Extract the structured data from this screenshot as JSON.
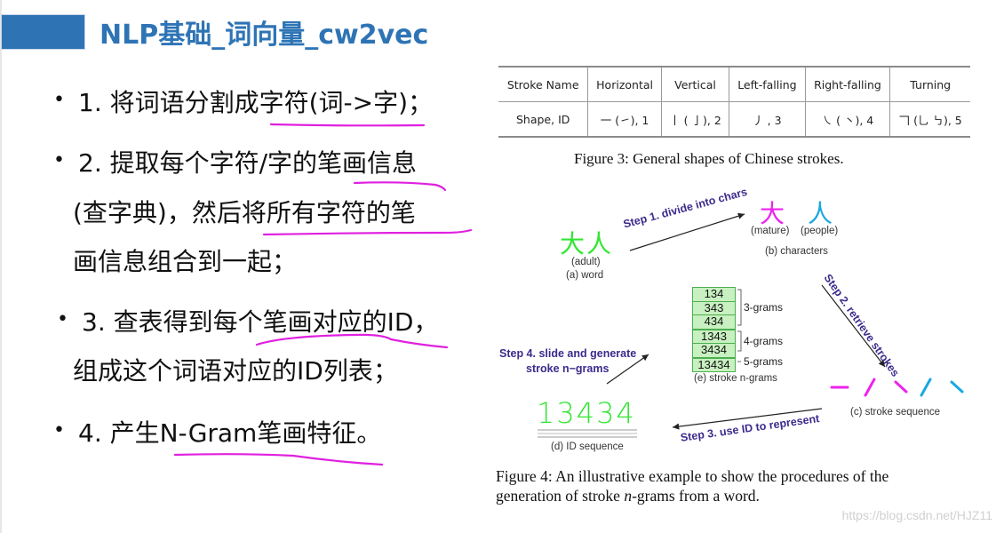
{
  "title": "NLP基础_词向量_cw2vec",
  "colors": {
    "title": "#2e74b5",
    "underline": "#e020e0",
    "green": "#33e633",
    "magenta": "#ee22ee",
    "cyan": "#1aa8e0",
    "step": "#3d2a8c"
  },
  "bullets": [
    {
      "lines": [
        "1. 将词语分割成字符(词->字)；"
      ]
    },
    {
      "lines": [
        "2. 提取每个字符/字的笔画信息",
        "(查字典)，然后将所有字符的笔",
        "画信息组合到一起；"
      ]
    },
    {
      "lines": [
        "3. 查表得到每个笔画对应的ID，",
        "组成这个词语对应的ID列表；"
      ]
    },
    {
      "lines": [
        "4. 产生N-Gram笔画特征。"
      ]
    }
  ],
  "figure3": {
    "header": [
      "Stroke Name",
      "Horizontal",
      "Vertical",
      "Left-falling",
      "Right-falling",
      "Turning"
    ],
    "row": [
      "Shape, ID",
      "一 (㇀), 1",
      "丨 ( 亅), 2",
      "丿 , 3",
      "㇏ ( 丶), 4",
      "𠃍 (乚 ㇉), 5"
    ],
    "caption": "Figure 3: General shapes of Chinese strokes."
  },
  "figure4": {
    "word": {
      "chars": "大人",
      "gloss": "(adult)",
      "label": "(a) word"
    },
    "characters": {
      "items": [
        {
          "char": "大",
          "gloss": "(mature)"
        },
        {
          "char": "人",
          "gloss": "(people)"
        }
      ],
      "label": "(b) characters"
    },
    "stroke_sequence_label": "(c) stroke sequence",
    "id_sequence": {
      "value": "13434",
      "label": "(d) ID sequence"
    },
    "ngrams": {
      "cells": [
        "134",
        "343",
        "434",
        "1343",
        "3434",
        "13434"
      ],
      "groups": [
        "3-grams",
        "4-grams",
        "5-grams"
      ],
      "label": "(e) stroke n-grams"
    },
    "steps": {
      "step1": "Step 1. divide into chars",
      "step2": "Step 2. retrieve strokes",
      "step3": "Step 3. use ID to represent",
      "step4_line1": "Step 4. slide and generate",
      "step4_line2": "stroke n−grams"
    },
    "caption_line1": "Figure 4: An illustrative example to show the procedures of the",
    "caption_line2_pre": "generation of stroke ",
    "caption_line2_italic": "n",
    "caption_line2_post": "-grams from a word."
  },
  "watermark": "https://blog.csdn.net/HJZ11"
}
